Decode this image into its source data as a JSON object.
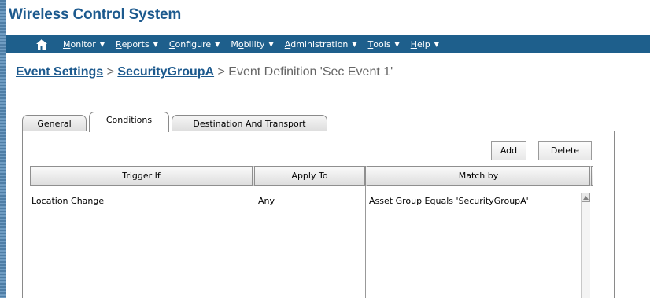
{
  "app": {
    "title": "Wireless Control System"
  },
  "nav": {
    "items": [
      {
        "pre": "",
        "mnemonic": "M",
        "post": "onitor"
      },
      {
        "pre": "",
        "mnemonic": "R",
        "post": "eports"
      },
      {
        "pre": "",
        "mnemonic": "C",
        "post": "onfigure"
      },
      {
        "pre": "M",
        "mnemonic": "o",
        "post": "bility"
      },
      {
        "pre": "",
        "mnemonic": "A",
        "post": "dministration"
      },
      {
        "pre": "",
        "mnemonic": "T",
        "post": "ools"
      },
      {
        "pre": "",
        "mnemonic": "H",
        "post": "elp"
      }
    ],
    "caret": "▼"
  },
  "breadcrumb": {
    "link1": "Event Settings",
    "sep1": " > ",
    "link2": "SecurityGroupA",
    "sep2": " > ",
    "current": "Event Definition 'Sec Event 1'"
  },
  "tabs": [
    "General",
    "Conditions",
    "Destination And Transport"
  ],
  "active_tab": "Conditions",
  "toolbar": {
    "add_label": "Add",
    "delete_label": "Delete"
  },
  "table": {
    "columns": [
      "Trigger If",
      "Apply To",
      "Match by"
    ],
    "rows": [
      [
        "Location Change",
        "Any",
        "Asset Group Equals 'SecurityGroupA'"
      ]
    ]
  },
  "colors": {
    "title": "#1d5a8e",
    "navbar": "#1e5f8c",
    "link": "#1d5a8e"
  },
  "icons": {
    "home": "home-icon",
    "scroll_up": "scroll-up-arrow-icon"
  }
}
